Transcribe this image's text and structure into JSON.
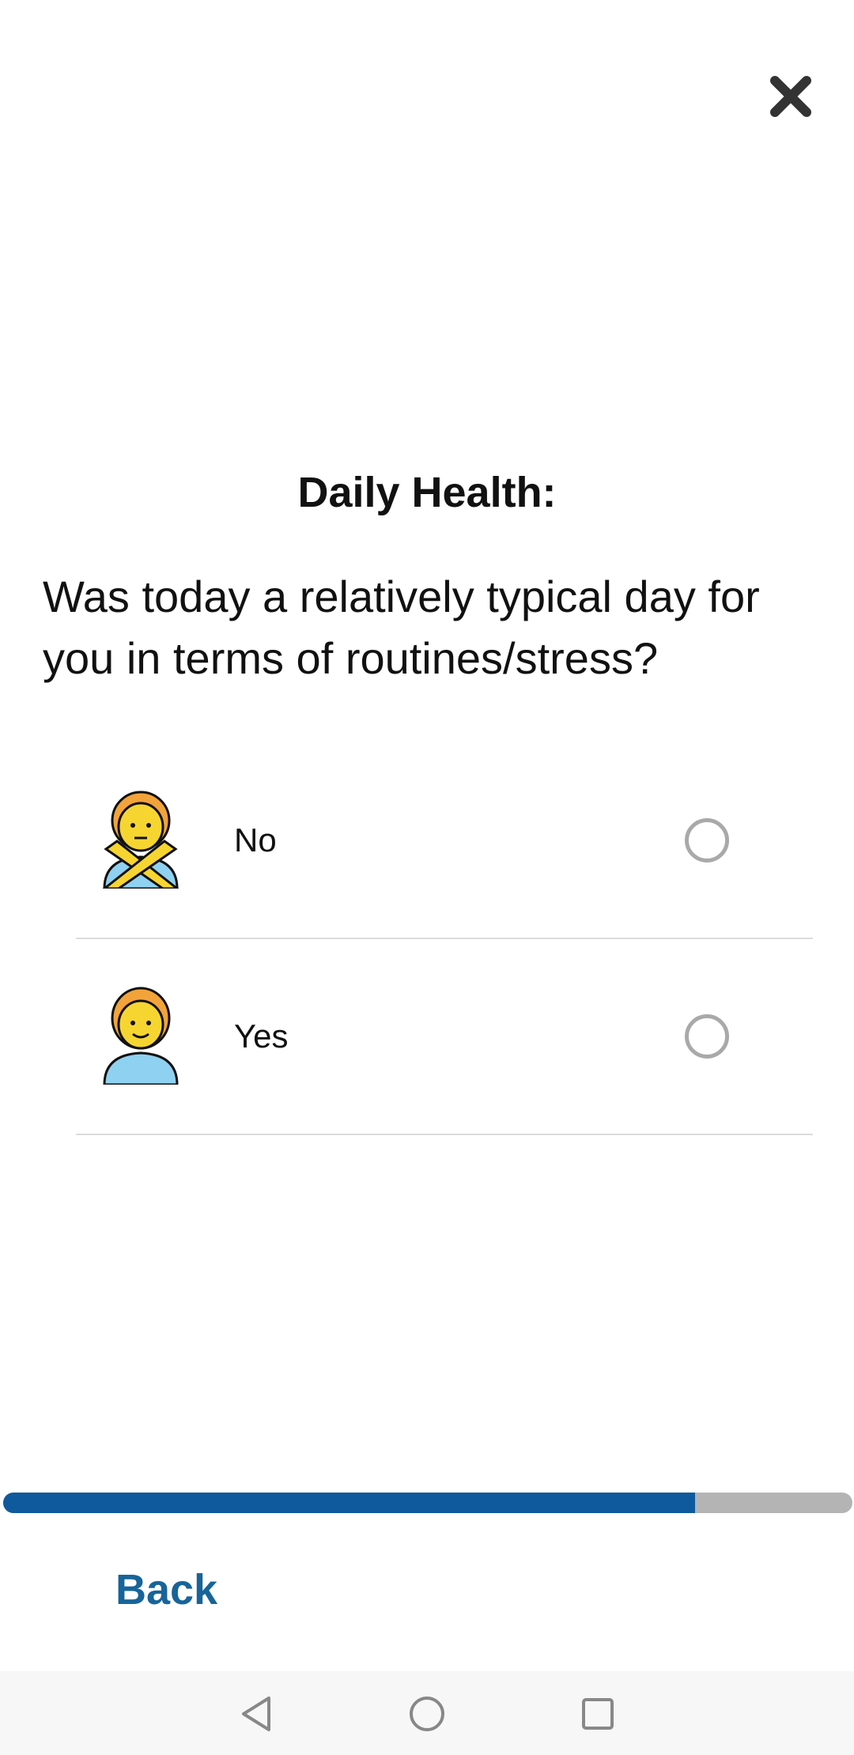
{
  "header": {
    "close_icon": "close-icon"
  },
  "survey": {
    "title": "Daily Health:",
    "question": "Was today a relatively typical day for you in terms of routines/stress?",
    "options": [
      {
        "label": "No",
        "icon": "person-gesturing-no-icon",
        "selected": false
      },
      {
        "label": "Yes",
        "icon": "person-icon",
        "selected": false
      }
    ]
  },
  "progress": {
    "fraction": 0.815,
    "fill_color": "#0f5a9c",
    "track_color": "#b4b4b4"
  },
  "footer": {
    "back_label": "Back",
    "back_color": "#17649a"
  },
  "system_nav": {
    "back_icon": "nav-back-icon",
    "home_icon": "nav-home-icon",
    "recents_icon": "nav-recents-icon"
  }
}
